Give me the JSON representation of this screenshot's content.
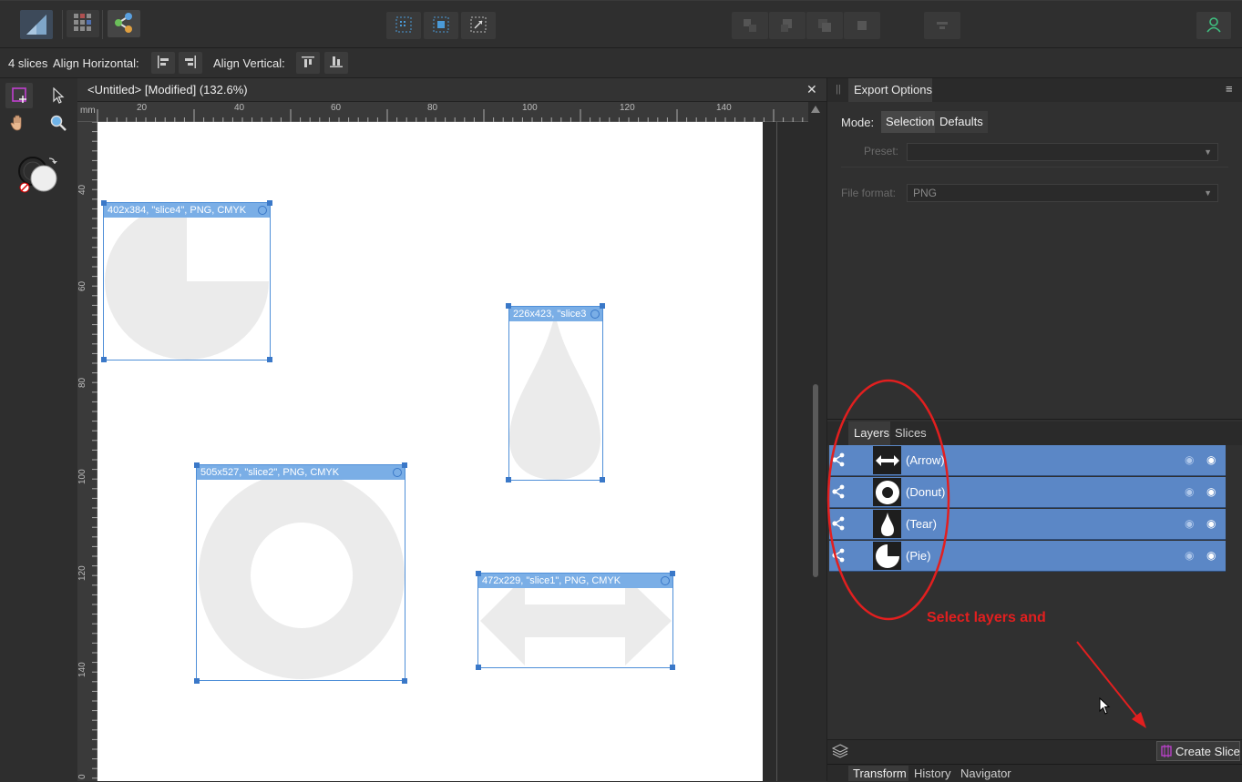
{
  "toolbar": {
    "personas": [
      "designer-persona",
      "pixel-persona",
      "export-persona"
    ],
    "icons": [
      "app-logo-icon",
      "grid-persona-icon",
      "export-persona-icon",
      "snap-grid-icon",
      "snap-bounds-icon",
      "snap-transform-icon",
      "align-icon-1",
      "align-icon-2",
      "align-icon-3",
      "align-icon-4",
      "distribute-icon",
      "user-icon"
    ]
  },
  "context": {
    "slice_count": "4 slices",
    "align_horizontal_label": "Align Horizontal:",
    "align_vertical_label": "Align Vertical:"
  },
  "document": {
    "tab_title": "<Untitled> [Modified] (132.6%)",
    "close_glyph": "✕"
  },
  "rulers": {
    "unit": "mm",
    "h_ticks": [
      "20",
      "40",
      "60",
      "80",
      "100",
      "120",
      "140"
    ],
    "v_ticks": [
      "40",
      "60",
      "80",
      "100",
      "120",
      "140",
      "0"
    ]
  },
  "slices": [
    {
      "label": "402x384, \"slice4\", PNG, CMYK",
      "shape": "pie"
    },
    {
      "label": "226x423, \"slice3",
      "shape": "tear"
    },
    {
      "label": "505x527, \"slice2\", PNG, CMYK",
      "shape": "donut"
    },
    {
      "label": "472x229, \"slice1\", PNG, CMYK",
      "shape": "arrow"
    }
  ],
  "export_panel": {
    "title": "Export Options",
    "mode_label": "Mode:",
    "mode_selection": "Selection",
    "mode_defaults": "Defaults",
    "preset_label": "Preset:",
    "preset_value": "",
    "file_format_label": "File format:",
    "file_format_value": "PNG"
  },
  "layers_panel": {
    "tab_layers": "Layers",
    "tab_slices": "Slices",
    "layers": [
      {
        "name": "(Arrow)",
        "icon": "arrow-thumb-icon"
      },
      {
        "name": "(Donut)",
        "icon": "donut-thumb-icon"
      },
      {
        "name": "(Tear)",
        "icon": "tear-thumb-icon"
      },
      {
        "name": "(Pie)",
        "icon": "pie-thumb-icon"
      }
    ]
  },
  "annotation": {
    "text": "Select layers and",
    "color": "#e21f1f"
  },
  "bottom": {
    "create_slice_label": "Create Slice",
    "tabs": [
      "Transform",
      "History",
      "Navigator"
    ]
  },
  "colors": {
    "selection": "#5b87c6",
    "slice_border": "#4f8fd8",
    "shape_fill": "#ebebeb",
    "accent_magenta": "#c040d0"
  }
}
